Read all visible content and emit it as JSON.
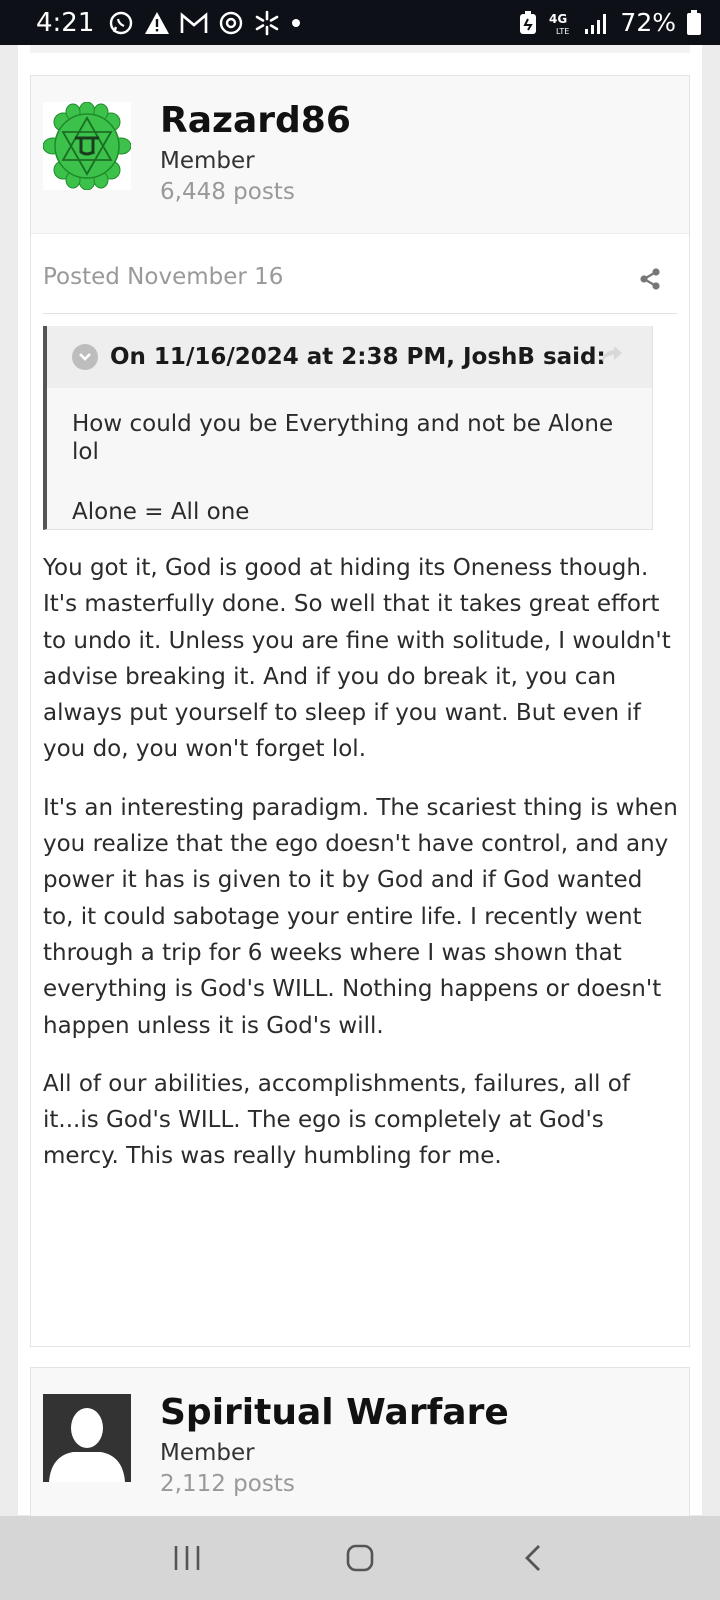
{
  "status_bar": {
    "time": "4:21",
    "battery_percent": "72%",
    "network_label": "4G LTE",
    "left_icons": [
      "whatsapp-icon",
      "warning-icon",
      "gmail-icon",
      "sync-icon",
      "walmart-spark-icon",
      "dot-icon"
    ],
    "right_icons": [
      "battery-saver-icon",
      "lte-icon",
      "signal-icon",
      "battery-icon"
    ]
  },
  "posts": [
    {
      "author": "Razard86",
      "role": "Member",
      "post_count": "6,448 posts",
      "posted": "Posted November 16",
      "quote": {
        "title": "On 11/16/2024 at 2:38 PM, JoshB said:",
        "lines": [
          "How could you be Everything and not be Alone lol",
          "Alone = All one"
        ]
      },
      "paragraphs": [
        "You got it, God is good at hiding its Oneness though. It's masterfully done. So well that it takes great effort to undo it. Unless you are fine with solitude, I wouldn't advise breaking it. And if you do break it, you can always put yourself to sleep if you want. But even if you do, you won't forget lol.",
        "It's an interesting paradigm. The scariest thing is when you realize that the ego doesn't have control, and any power it has is given to it by God and if God wanted to, it could sabotage your entire life. I recently went through a trip for 6 weeks where I was shown that everything is God's WILL. Nothing happens or doesn't happen unless it is God's will.",
        "All of our abilities, accomplishments, failures, all of it...is God's WILL. The ego is completely at God's mercy. This was really humbling for me."
      ]
    },
    {
      "author": "Spiritual Warfare",
      "role": "Member",
      "post_count": "2,112 posts"
    }
  ],
  "colors": {
    "avatar_green": "#3cc24a",
    "status_bar_bg": "#0d1117",
    "nav_bar_bg": "#d6d6d6"
  },
  "nav_bar": [
    "recent-apps-icon",
    "home-icon",
    "back-icon"
  ]
}
